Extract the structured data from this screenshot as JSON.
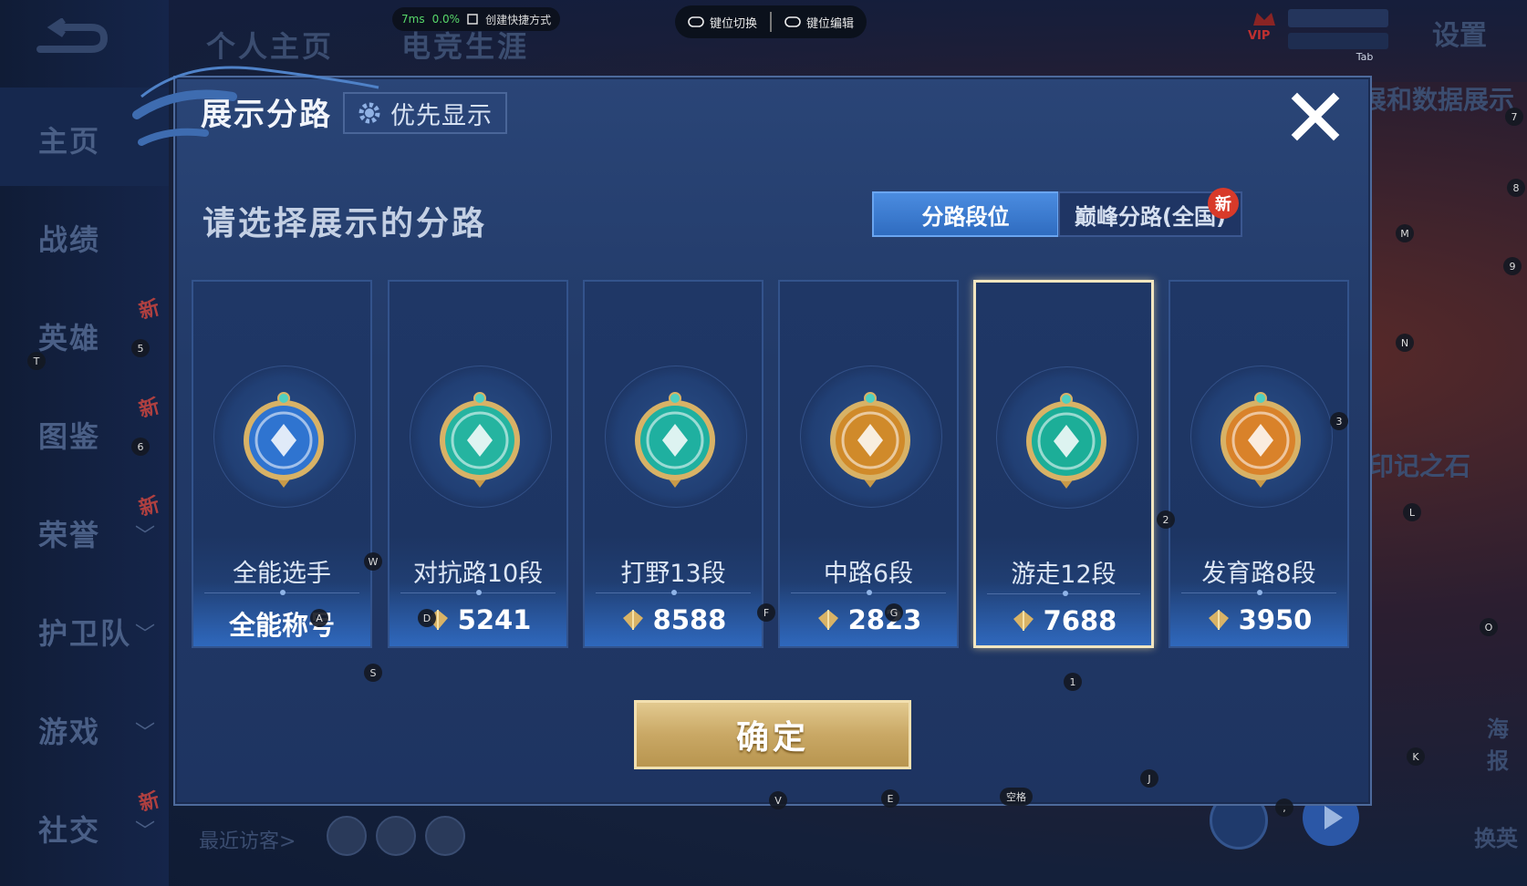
{
  "background": {
    "top_tabs": [
      "个人主页",
      "电竞生涯"
    ],
    "settings_label": "设置",
    "vip_label": "VIP",
    "right_texts": [
      "展和数据展示",
      "印记之石",
      "海报",
      "换英"
    ],
    "recent_visitors_label": "最近访客>",
    "sidebar": [
      {
        "label": "主页",
        "active": true,
        "chevron": false,
        "new": false
      },
      {
        "label": "战绩",
        "active": false,
        "chevron": false,
        "new": false
      },
      {
        "label": "英雄",
        "active": false,
        "chevron": false,
        "new": true
      },
      {
        "label": "图鉴",
        "active": false,
        "chevron": false,
        "new": true
      },
      {
        "label": "荣誉",
        "active": false,
        "chevron": true,
        "new": true
      },
      {
        "label": "护卫队",
        "active": false,
        "chevron": true,
        "new": false
      },
      {
        "label": "游戏",
        "active": false,
        "chevron": true,
        "new": false
      },
      {
        "label": "社交",
        "active": false,
        "chevron": true,
        "new": true
      }
    ],
    "sidebar_new_tag": "新",
    "sidebar_chevron": "﹀"
  },
  "overlay": {
    "latency": "7ms",
    "cpu": "0.0%",
    "shortcut_label": "创建快捷方式",
    "key_switch_label": "键位切换",
    "key_edit_label": "键位编辑",
    "key_hints": [
      "Tab",
      "7",
      "8",
      "M",
      "9",
      "N",
      "3",
      "L",
      "2",
      "O",
      "K",
      "J",
      "1",
      "T",
      "5",
      "6",
      "W",
      "A",
      "D",
      "S",
      "F",
      "G",
      "V",
      "E",
      "空格",
      ","
    ]
  },
  "dialog": {
    "title": "展示分路",
    "priority_label": "优先显示",
    "subtitle": "请选择展示的分路",
    "segment_active": "分路段位",
    "segment_other": "巅峰分路(全国)",
    "new_tag": "新",
    "confirm_label": "确定",
    "accent_gold": "#e2c98f",
    "accent_blue": "#3f7fd4",
    "cards": [
      {
        "name": "全能选手",
        "value": "全能称号",
        "icon": "all-round-emblem-icon",
        "selected": false,
        "diamond": false,
        "color": "#2f74d0"
      },
      {
        "name": "对抗路10段",
        "value": "5241",
        "icon": "clash-lane-emblem-icon",
        "selected": false,
        "diamond": true,
        "color": "#25b4a0"
      },
      {
        "name": "打野13段",
        "value": "8588",
        "icon": "jungle-emblem-icon",
        "selected": false,
        "diamond": true,
        "color": "#1fb0a0"
      },
      {
        "name": "中路6段",
        "value": "2823",
        "icon": "mid-lane-emblem-icon",
        "selected": false,
        "diamond": true,
        "color": "#d08a2a"
      },
      {
        "name": "游走12段",
        "value": "7688",
        "icon": "roam-emblem-icon",
        "selected": true,
        "diamond": true,
        "color": "#1cae98"
      },
      {
        "name": "发育路8段",
        "value": "3950",
        "icon": "farm-lane-emblem-icon",
        "selected": false,
        "diamond": true,
        "color": "#d9822a"
      }
    ]
  }
}
